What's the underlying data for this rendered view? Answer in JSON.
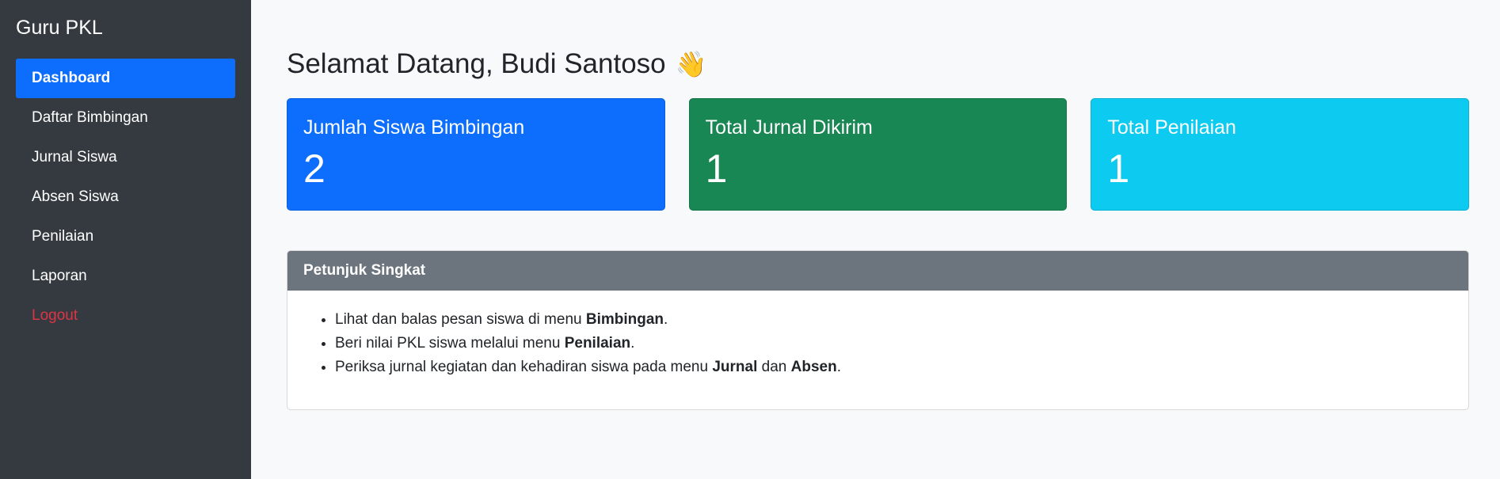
{
  "sidebar": {
    "brand": "Guru PKL",
    "items": [
      {
        "label": "Dashboard"
      },
      {
        "label": "Daftar Bimbingan"
      },
      {
        "label": "Jurnal Siswa"
      },
      {
        "label": "Absen Siswa"
      },
      {
        "label": "Penilaian"
      },
      {
        "label": "Laporan"
      },
      {
        "label": "Logout"
      }
    ]
  },
  "main": {
    "title": "Selamat Datang, Budi Santoso",
    "title_emoji": "👋",
    "cards": [
      {
        "title": "Jumlah Siswa Bimbingan",
        "value": "2",
        "color": "#0d6efd"
      },
      {
        "title": "Total Jurnal Dikirim",
        "value": "1",
        "color": "#198754"
      },
      {
        "title": "Total Penilaian",
        "value": "1",
        "color": "#0dcaf0"
      }
    ],
    "panel": {
      "header": "Petunjuk Singkat",
      "items": [
        {
          "pre": "Lihat dan balas pesan siswa di menu ",
          "b1": "Bimbingan",
          "mid": "",
          "b2": "",
          "post": "."
        },
        {
          "pre": "Beri nilai PKL siswa melalui menu ",
          "b1": "Penilaian",
          "mid": "",
          "b2": "",
          "post": "."
        },
        {
          "pre": "Periksa jurnal kegiatan dan kehadiran siswa pada menu ",
          "b1": "Jurnal",
          "mid": " dan ",
          "b2": "Absen",
          "post": "."
        }
      ]
    }
  }
}
